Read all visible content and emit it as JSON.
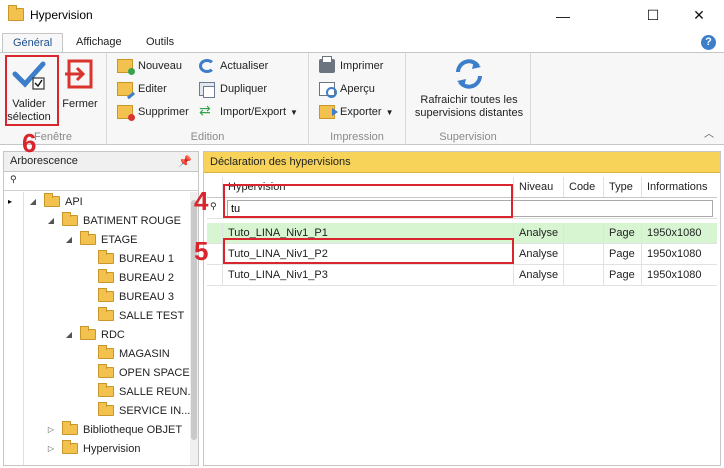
{
  "window": {
    "title": "Hypervision",
    "minimize": "—",
    "maximize": "☐",
    "close": "✕"
  },
  "tabs": [
    {
      "label": "Général",
      "active": true
    },
    {
      "label": "Affichage",
      "active": false
    },
    {
      "label": "Outils",
      "active": false
    }
  ],
  "help_label": "?",
  "ribbon": {
    "fenetre": {
      "label": "Fenêtre",
      "validate": "Valider\nsélection",
      "close": "Fermer"
    },
    "edition": {
      "label": "Edition",
      "new": "Nouveau",
      "edit": "Editer",
      "delete": "Supprimer",
      "refresh": "Actualiser",
      "duplicate": "Dupliquer",
      "import_export": "Import/Export"
    },
    "impression": {
      "label": "Impression",
      "print": "Imprimer",
      "preview": "Aperçu",
      "export": "Exporter"
    },
    "supervision": {
      "label": "Supervision",
      "refresh_all": "Rafraichir toutes les\nsupervisions distantes"
    }
  },
  "annotations": {
    "n6": "6",
    "n4": "4",
    "n5": "5"
  },
  "tree": {
    "title": "Arborescence",
    "pin": "📌",
    "filter_icon": "⚲",
    "items": [
      {
        "label": "API",
        "depth": 0,
        "exp": "◢",
        "indicator": "▸"
      },
      {
        "label": "BATIMENT ROUGE",
        "depth": 1,
        "exp": "◢"
      },
      {
        "label": "ETAGE",
        "depth": 2,
        "exp": "◢"
      },
      {
        "label": "BUREAU 1",
        "depth": 3,
        "exp": ""
      },
      {
        "label": "BUREAU 2",
        "depth": 3,
        "exp": ""
      },
      {
        "label": "BUREAU 3",
        "depth": 3,
        "exp": ""
      },
      {
        "label": "SALLE TEST",
        "depth": 3,
        "exp": ""
      },
      {
        "label": "RDC",
        "depth": 2,
        "exp": "◢"
      },
      {
        "label": "MAGASIN",
        "depth": 3,
        "exp": ""
      },
      {
        "label": "OPEN SPACE",
        "depth": 3,
        "exp": ""
      },
      {
        "label": "SALLE REUN...",
        "depth": 3,
        "exp": ""
      },
      {
        "label": "SERVICE IN...",
        "depth": 3,
        "exp": ""
      },
      {
        "label": "Bibliotheque OBJET",
        "depth": 1,
        "exp": "▷"
      },
      {
        "label": "Hypervision",
        "depth": 1,
        "exp": "▷"
      }
    ]
  },
  "hypervisions": {
    "title": "Déclaration des hypervisions",
    "columns": [
      "Hypervision",
      "Niveau",
      "Code",
      "Type",
      "Informations"
    ],
    "filter_value": "tu",
    "rows": [
      {
        "name": "Tuto_LINA_Niv1_P1",
        "niveau": "Analyse",
        "code": "",
        "type": "Page",
        "info": "1950x1080",
        "selected": true
      },
      {
        "name": "Tuto_LINA_Niv1_P2",
        "niveau": "Analyse",
        "code": "",
        "type": "Page",
        "info": "1950x1080",
        "selected": false
      },
      {
        "name": "Tuto_LINA_Niv1_P3",
        "niveau": "Analyse",
        "code": "",
        "type": "Page",
        "info": "1950x1080",
        "selected": false
      }
    ]
  }
}
